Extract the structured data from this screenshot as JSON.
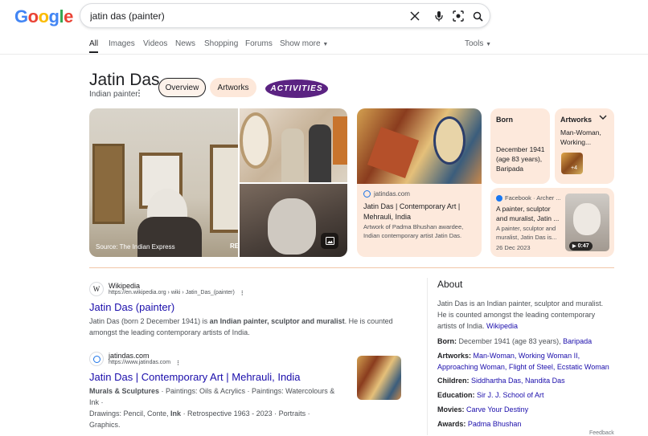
{
  "search": {
    "query": "jatin das (painter)"
  },
  "logo": {
    "letters": [
      "G",
      "o",
      "o",
      "g",
      "l",
      "e"
    ],
    "colors": [
      "#4285f4",
      "#ea4335",
      "#fbbc05",
      "#4285f4",
      "#34a853",
      "#ea4335"
    ]
  },
  "tabs": [
    "All",
    "Images",
    "Videos",
    "News",
    "Shopping",
    "Forums",
    "Show more",
    "Tools"
  ],
  "entity": {
    "title": "Jatin Das",
    "subtitle": "Indian painter",
    "pills": [
      "Overview",
      "Artworks",
      "ACTIVITIES"
    ]
  },
  "photo_caption": "Source: The Indian Express",
  "photo_caption_right": "RE",
  "site_card": {
    "domain": "jatindas.com",
    "title": "Jatin Das | Contemporary Art | Mehrauli, India",
    "desc": "Artwork of Padma Bhushan awardee, Indian contemporary artist Jatin Das."
  },
  "born_card": {
    "label": "Born",
    "value": "December 1941 (age 83 years), Baripada"
  },
  "artworks_card": {
    "label": "Artworks",
    "value": "Man-Woman, Working...",
    "more": "+4"
  },
  "fb_card": {
    "source": "Facebook · Archer ...",
    "text": "A painter, sculptor and muralist, Jatin ...",
    "text2": "A painter, sculptor and muralist, Jatin Das is...",
    "date": "26 Dec 2023",
    "duration": "0:47"
  },
  "results": [
    {
      "site": "Wikipedia",
      "url": "https://en.wikipedia.org › wiki › Jatin_Das_(painter)",
      "title": "Jatin Das (painter)",
      "snippet_pre": "Jatin Das (born 2 December 1941) is ",
      "snippet_bold": "an Indian painter, sculptor and muralist",
      "snippet_post": ". He is counted amongst the leading contemporary artists of India."
    },
    {
      "site": "jatindas.com",
      "url": "https://www.jatindas.com",
      "title": "Jatin Das | Contemporary Art | Mehrauli, India",
      "line1_bold": "Murals & Sculptures",
      "line1_rest": " · Paintings: Oils & Acrylics · Paintings: Watercolours & Ink ·",
      "line2_pre": "Drawings: Pencil, Conte, ",
      "line2_bold": "Ink",
      "line2_post": " · Retrospective 1963 - 2023 · Portraits · Graphics."
    }
  ],
  "about": {
    "heading": "About",
    "desc": "Jatin Das is an Indian painter, sculptor and muralist. He is counted amongst the leading contemporary artists of India.",
    "desc_link": "Wikipedia",
    "born_label": "Born:",
    "born_value": "December 1941 (age 83 years), ",
    "born_link": "Baripada",
    "artworks_label": "Artworks:",
    "artworks_value": "Man-Woman, Working Woman II, Approaching Woman, Flight of Steel, Ecstatic Woman",
    "children_label": "Children:",
    "children_value": "Siddhartha Das, Nandita Das",
    "education_label": "Education:",
    "education_value": "Sir J. J. School of Art",
    "movies_label": "Movies:",
    "movies_value": "Carve Your Destiny",
    "awards_label": "Awards:",
    "awards_value": "Padma Bhushan",
    "feedback": "Feedback"
  }
}
